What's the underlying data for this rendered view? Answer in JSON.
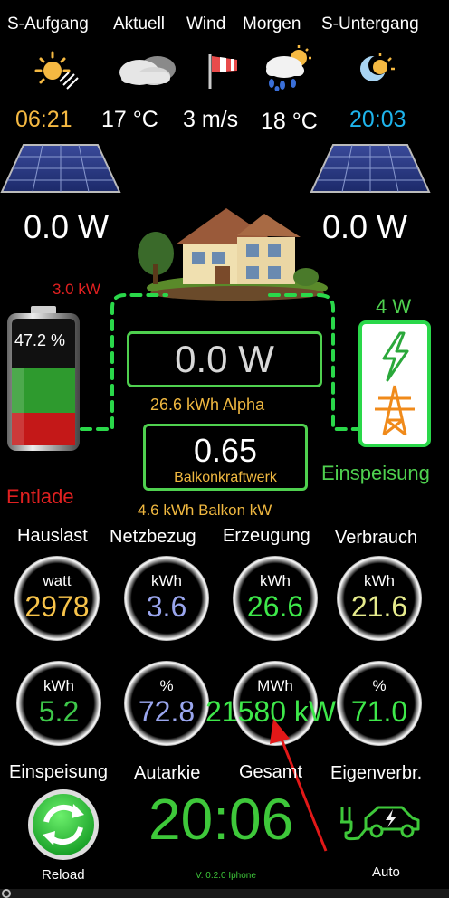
{
  "header": {
    "labels": [
      "S-Aufgang",
      "Aktuell",
      "Wind",
      "Morgen",
      "S-Untergang"
    ],
    "values": [
      "06:21",
      "17 °C",
      "3 m/s",
      "18 °C",
      "20:03"
    ],
    "colors": [
      "#f5b942",
      "#ffffff",
      "#ffffff",
      "#ffffff",
      "#1eb4ec"
    ],
    "icons": [
      "sunrise-icon",
      "cloud-icon",
      "windsock-icon",
      "rain-sun-icon",
      "sunset-icon"
    ]
  },
  "solar": {
    "left_power": "0.0 W",
    "right_power": "0.0 W"
  },
  "battery": {
    "discharge_power": "3.0 kW",
    "soc": "47.2 %",
    "soc_value": 47.2,
    "state": "Entlade"
  },
  "center": {
    "house_power": "0.0 W",
    "alpha_energy": "26.6 kWh Alpha",
    "balkon_value": "0.65",
    "balkon_label": "Balkonkraftwerk",
    "balkon_energy": "4.6 kWh Balkon kW"
  },
  "grid": {
    "power": "4 W",
    "label": "Einspeisung"
  },
  "stats_row1": {
    "labels": [
      "Hauslast",
      "Netzbezug",
      "Erzeugung",
      "Verbrauch"
    ],
    "gauges": [
      {
        "unit": "watt",
        "value": "2978",
        "color": "#f8c44a"
      },
      {
        "unit": "kWh",
        "value": "3.6",
        "color": "#9aa6ee"
      },
      {
        "unit": "kWh",
        "value": "26.6",
        "color": "#3ee84a"
      },
      {
        "unit": "kWh",
        "value": "21.6",
        "color": "#e6eb8c"
      }
    ]
  },
  "stats_row2": {
    "labels": [
      "Einspeisung",
      "Autarkie",
      "Gesamt",
      "Eigenverbr."
    ],
    "gauges": [
      {
        "unit": "kWh",
        "value": "5.2",
        "color": "#3ec84a"
      },
      {
        "unit": "%",
        "value": "72.8",
        "color": "#9aa6ee"
      },
      {
        "unit": "MWh",
        "value": "21580 kW",
        "color": "#3ee84a"
      },
      {
        "unit": "%",
        "value": "71.0",
        "color": "#3ee84a"
      }
    ]
  },
  "footer": {
    "reload_label": "Reload",
    "clock": "20:06",
    "version": "V. 0.2.0 Iphone",
    "auto_label": "Auto"
  }
}
